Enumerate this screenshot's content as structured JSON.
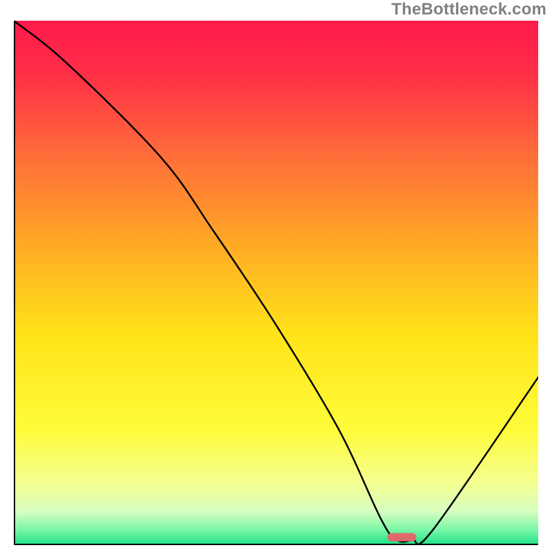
{
  "watermark": "TheBottleneck.com",
  "chart_data": {
    "type": "line",
    "title": "",
    "xlabel": "",
    "ylabel": "",
    "xlim": [
      0,
      100
    ],
    "ylim": [
      0,
      100
    ],
    "grid": false,
    "axes_visible": false,
    "background_gradient_stops": [
      {
        "pos": 0.0,
        "color": "#ff1a4b"
      },
      {
        "pos": 0.1,
        "color": "#ff2e47"
      },
      {
        "pos": 0.25,
        "color": "#ff6a3a"
      },
      {
        "pos": 0.45,
        "color": "#ffb222"
      },
      {
        "pos": 0.6,
        "color": "#ffe319"
      },
      {
        "pos": 0.78,
        "color": "#fffc3a"
      },
      {
        "pos": 0.88,
        "color": "#f4ff8f"
      },
      {
        "pos": 0.935,
        "color": "#d8ffc0"
      },
      {
        "pos": 0.97,
        "color": "#7bf7a8"
      },
      {
        "pos": 1.0,
        "color": "#1ee085"
      }
    ],
    "series": [
      {
        "name": "curve",
        "color": "#000000",
        "stroke_width": 2.5,
        "x": [
          0,
          10,
          28,
          38,
          50,
          62,
          70,
          73,
          76,
          80,
          100
        ],
        "y": [
          100,
          92,
          74,
          60,
          42,
          22,
          5,
          1,
          1,
          3,
          32
        ]
      }
    ],
    "marker": {
      "name": "bottleneck-marker",
      "x_center": 74,
      "y": 1.5,
      "width_pct": 5.5,
      "height_pct": 1.6,
      "color": "#e06a6a"
    },
    "frame": {
      "left_edge": true,
      "bottom_edge": true,
      "color": "#000000",
      "width": 2
    }
  }
}
